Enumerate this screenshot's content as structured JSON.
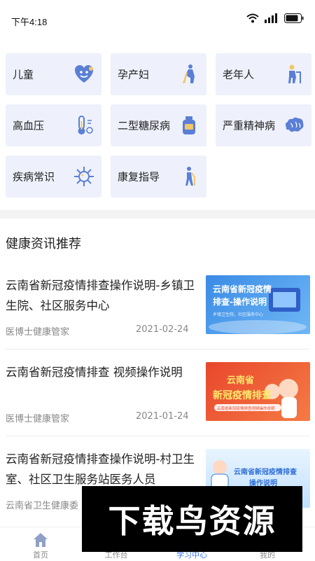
{
  "status": {
    "time": "下午4:18"
  },
  "categories": [
    {
      "label": "儿童",
      "icon": "baby-face-icon"
    },
    {
      "label": "孕产妇",
      "icon": "pregnant-woman-icon"
    },
    {
      "label": "老年人",
      "icon": "elderly-person-icon"
    },
    {
      "label": "高血压",
      "icon": "thermometer-icon"
    },
    {
      "label": "二型糖尿病",
      "icon": "medicine-bottle-icon"
    },
    {
      "label": "严重精神病",
      "icon": "brain-icon"
    },
    {
      "label": "疾病常识",
      "icon": "virus-icon"
    },
    {
      "label": "康复指导",
      "icon": "walking-person-icon"
    }
  ],
  "section": {
    "title": "健康资讯推荐"
  },
  "news": [
    {
      "title": "云南省新冠疫情排查操作说明-乡镇卫生院、社区服务中心",
      "source": "医博士健康管家",
      "date": "2021-02-24",
      "thumb_title": "云南省新冠疫情\n排查-操作说明",
      "thumb_sub": "乡镇卫生院，社区服务中心"
    },
    {
      "title": "云南省新冠疫情排查 视频操作说明",
      "source": "医博士健康管家",
      "date": "2021-01-24",
      "thumb_title": "云南省\n新冠疫情排查",
      "thumb_sub": "云南省新冠疫情排查视频操作说明"
    },
    {
      "title": "云南省新冠疫情排查操作说明-村卫生室、社区卫生服务站医务人员",
      "source": "云南省卫生健康委",
      "date": "",
      "thumb_title": "云南省新冠疫情排查\n操作说明",
      "thumb_sub": ""
    }
  ],
  "tabs": [
    {
      "label": "首页",
      "icon": "home-icon",
      "active": false
    },
    {
      "label": "工作台",
      "icon": "workbench-icon",
      "active": false
    },
    {
      "label": "学习中心",
      "icon": "study-icon",
      "active": true
    },
    {
      "label": "我的",
      "icon": "user-icon",
      "active": false
    }
  ],
  "watermark": {
    "text": "下载鸟资源"
  },
  "colors": {
    "tile_bg": "#eef1fb",
    "accent": "#3f7bea",
    "icon_blue": "#5b7fd6"
  }
}
